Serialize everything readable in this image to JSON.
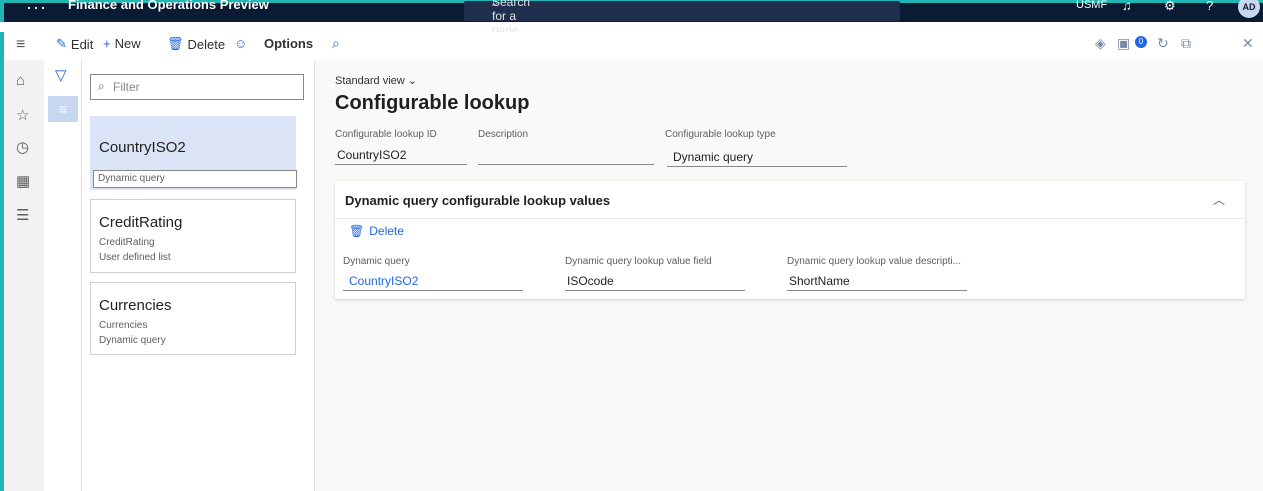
{
  "topbar": {
    "app_title": "Finance and Operations Preview",
    "search_placeholder": "Search for a page",
    "company": "USMF",
    "avatar_initials": "AD",
    "accent_color": "#1eb7b5"
  },
  "actionbar": {
    "edit": "Edit",
    "new": "New",
    "delete": "Delete",
    "options": "Options",
    "notification_count": "0"
  },
  "list": {
    "filter_placeholder": "Filter",
    "items": [
      {
        "title": "CountryISO2",
        "line1": "Dynamic query",
        "selected": true
      },
      {
        "title": "CreditRating",
        "line1": "CreditRating",
        "line2": "User defined list"
      },
      {
        "title": "Currencies",
        "line1": "Currencies",
        "line2": "Dynamic query"
      }
    ]
  },
  "form": {
    "view_name": "Standard view",
    "title": "Configurable lookup",
    "fields": {
      "lookup_id_label": "Configurable lookup ID",
      "lookup_id_value": "CountryISO2",
      "description_label": "Description",
      "description_value": "",
      "lookup_type_label": "Configurable lookup type",
      "lookup_type_value": "Dynamic query"
    },
    "fasttab": {
      "title": "Dynamic query configurable lookup values",
      "delete_label": "Delete",
      "dq_label": "Dynamic query",
      "dq_value": "CountryISO2",
      "value_field_label": "Dynamic query lookup value field",
      "value_field_value": "ISOcode",
      "value_desc_label": "Dynamic query lookup value descripti...",
      "value_desc_value": "ShortName"
    }
  }
}
